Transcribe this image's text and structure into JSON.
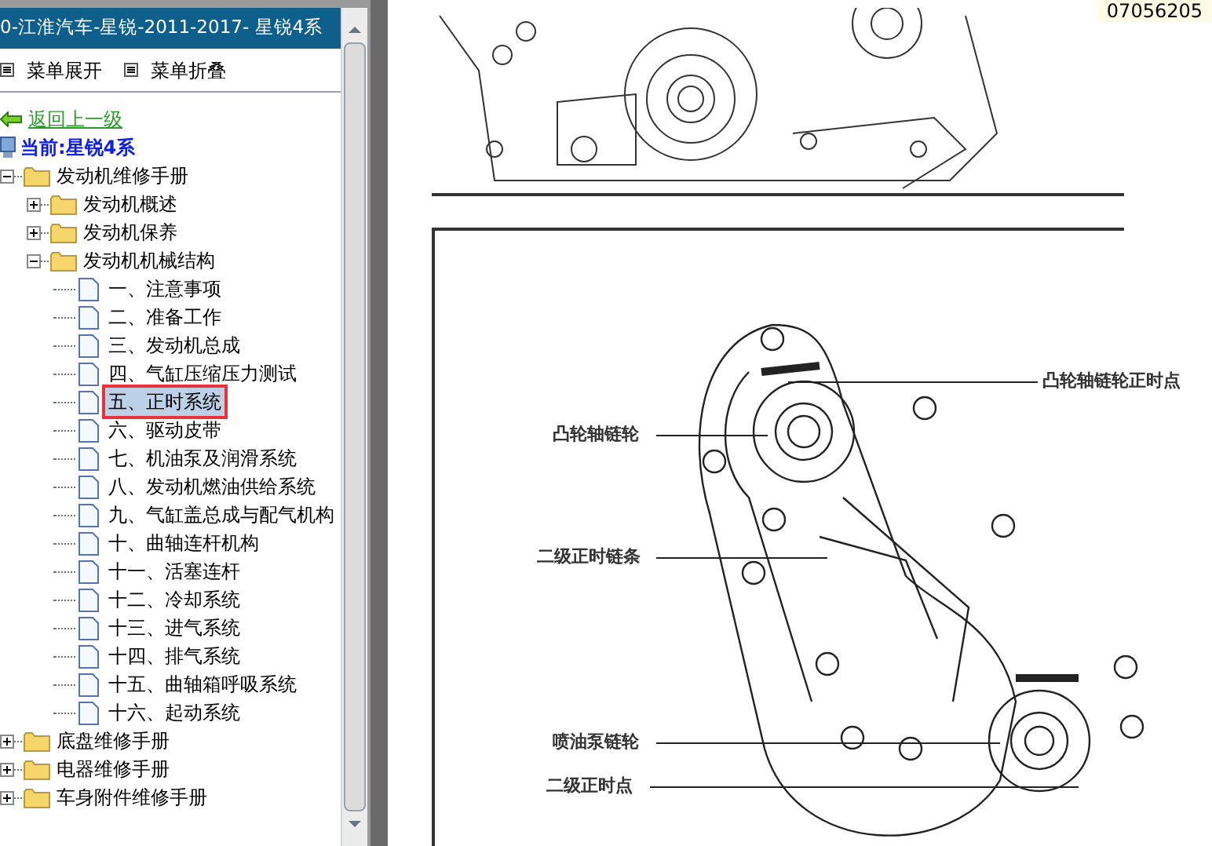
{
  "sidebar": {
    "title": "0-江淮汽车-星锐-2011-2017- 星锐4系",
    "menu_buttons": [
      {
        "label": "菜单展开"
      },
      {
        "label": "菜单折叠"
      }
    ],
    "back_link": "返回上一级",
    "current": "当前:星锐4系",
    "tree": [
      {
        "label": "发动机维修手册",
        "expanded": true,
        "children": [
          {
            "label": "发动机概述",
            "expanded": false
          },
          {
            "label": "发动机保养",
            "expanded": false
          },
          {
            "label": "发动机机械结构",
            "expanded": true,
            "children": [
              {
                "label": "一、注意事项",
                "selected": false
              },
              {
                "label": "二、准备工作",
                "selected": false
              },
              {
                "label": "三、发动机总成",
                "selected": false
              },
              {
                "label": "四、气缸压缩压力测试",
                "selected": false
              },
              {
                "label": "五、正时系统",
                "selected": true
              },
              {
                "label": "六、驱动皮带",
                "selected": false
              },
              {
                "label": "七、机油泵及润滑系统",
                "selected": false
              },
              {
                "label": "八、发动机燃油供给系统",
                "selected": false
              },
              {
                "label": "九、气缸盖总成与配气机构",
                "selected": false
              },
              {
                "label": "十、曲轴连杆机构",
                "selected": false
              },
              {
                "label": "十一、活塞连杆",
                "selected": false
              },
              {
                "label": "十二、冷却系统",
                "selected": false
              },
              {
                "label": "十三、进气系统",
                "selected": false
              },
              {
                "label": "十四、排气系统",
                "selected": false
              },
              {
                "label": "十五、曲轴箱呼吸系统",
                "selected": false
              },
              {
                "label": "十六、起动系统",
                "selected": false
              }
            ]
          }
        ]
      },
      {
        "label": "底盘维修手册",
        "expanded": false
      },
      {
        "label": "电器维修手册",
        "expanded": false
      },
      {
        "label": "车身附件维修手册",
        "expanded": false
      }
    ]
  },
  "document": {
    "top_code": "07056205",
    "diagram_labels": [
      {
        "text": "凸轮轴链轮正时点"
      },
      {
        "text": "凸轮轴链轮"
      },
      {
        "text": "二级正时链条"
      },
      {
        "text": "喷油泵链轮"
      },
      {
        "text": "二级正时点"
      }
    ]
  }
}
